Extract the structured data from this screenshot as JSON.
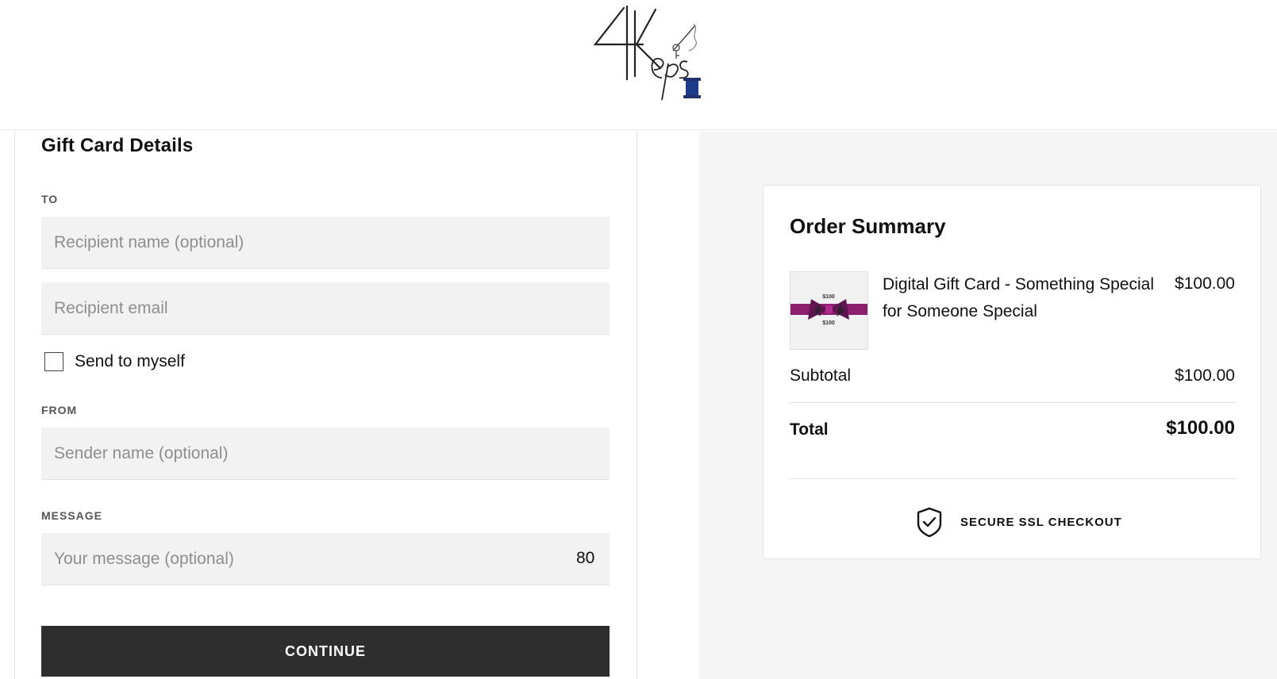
{
  "header": {
    "logo_alt": "4Keps"
  },
  "form": {
    "title": "Gift Card Details",
    "to_label": "TO",
    "recipient_name_placeholder": "Recipient name (optional)",
    "recipient_email_placeholder": "Recipient email",
    "send_to_myself_label": "Send to myself",
    "from_label": "FROM",
    "sender_name_placeholder": "Sender name (optional)",
    "message_label": "MESSAGE",
    "message_placeholder": "Your message (optional)",
    "message_char_count": "80",
    "continue_label": "CONTINUE"
  },
  "summary": {
    "title": "Order Summary",
    "product": {
      "name": "Digital Gift Card - Something Special for Someone Special",
      "price": "$100.00",
      "thumb_text_top": "$100",
      "thumb_text_bottom": "$100"
    },
    "subtotal_label": "Subtotal",
    "subtotal_value": "$100.00",
    "total_label": "Total",
    "total_value": "$100.00",
    "secure_label": "SECURE SSL CHECKOUT"
  },
  "colors": {
    "button_bg": "#2e2e2e",
    "input_bg": "#f2f2f2",
    "right_panel_bg": "#f5f5f5",
    "logo_accent": "#1d3a8a",
    "gift_card_accent": "#8b1f6e"
  }
}
